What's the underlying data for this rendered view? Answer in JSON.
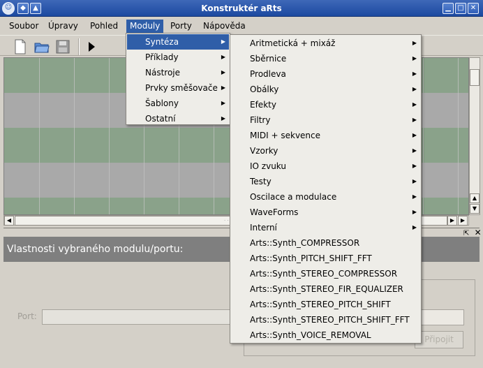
{
  "window": {
    "title": "Konstruktér aRts"
  },
  "menubar": {
    "items": [
      "Soubor",
      "Úpravy",
      "Pohled",
      "Moduly",
      "Porty",
      "Nápověda"
    ],
    "active": "Moduly"
  },
  "moduly_menu": {
    "items": [
      "Syntéza",
      "Příklady",
      "Nástroje",
      "Prvky směšovače",
      "Šablony",
      "Ostatní"
    ],
    "highlighted": "Syntéza"
  },
  "synteza_menu": {
    "submenus": [
      "Aritmetická + mixáž",
      "Sběrnice",
      "Prodleva",
      "Obálky",
      "Efekty",
      "Filtry",
      "MIDI + sekvence",
      "Vzorky",
      "IO zvuku",
      "Testy",
      "Oscilace a modulace",
      "WaveForms",
      "Interní"
    ],
    "modules": [
      "Arts::Synth_COMPRESSOR",
      "Arts::Synth_PITCH_SHIFT_FFT",
      "Arts::Synth_STEREO_COMPRESSOR",
      "Arts::Synth_STEREO_FIR_EQUALIZER",
      "Arts::Synth_STEREO_PITCH_SHIFT",
      "Arts::Synth_STEREO_PITCH_SHIFT_FFT",
      "Arts::Synth_VOICE_REMOVAL"
    ]
  },
  "properties": {
    "title": "Vlastnosti vybraného modulu/portu:",
    "port_label": "Port:",
    "connect_label": "Připojit"
  },
  "colors": {
    "titlebar": "#2f5eb8",
    "highlight": "#2f5ea8",
    "canvas_green": "#8aa28a",
    "canvas_gray": "#a9a9a9",
    "prop_bar": "#7f7f7f"
  },
  "icons": [
    "kde-menu-icon",
    "pin-icon",
    "shade-icon",
    "minimize-icon",
    "maximize-icon",
    "close-icon",
    "new-file-icon",
    "open-folder-icon",
    "save-disk-icon",
    "play-icon"
  ]
}
